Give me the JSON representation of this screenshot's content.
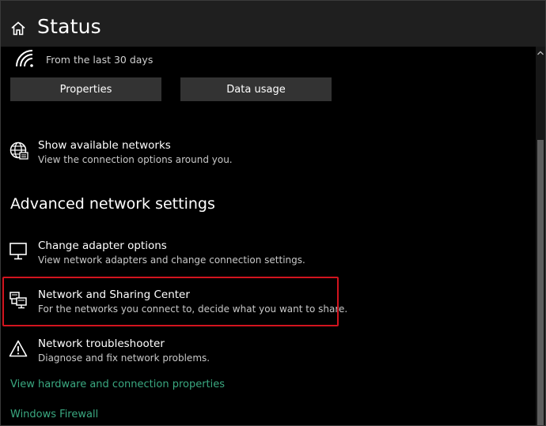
{
  "header": {
    "title": "Status",
    "home_icon": "home-icon"
  },
  "connection": {
    "usage_period": "From the last 30 days",
    "wifi_icon": "wifi-icon"
  },
  "buttons": {
    "properties": "Properties",
    "data_usage": "Data usage"
  },
  "items": {
    "available": {
      "title": "Show available networks",
      "description": "View the connection options around you.",
      "icon": "globe-icon"
    },
    "adapter": {
      "title": "Change adapter options",
      "description": "View network adapters and change connection settings.",
      "icon": "monitor-icon"
    },
    "sharing": {
      "title": "Network and Sharing Center",
      "description": "For the networks you connect to, decide what you want to share.",
      "icon": "network-sharing-icon"
    },
    "troubleshooter": {
      "title": "Network troubleshooter",
      "description": "Diagnose and fix network problems.",
      "icon": "warning-icon"
    }
  },
  "advanced": {
    "heading": "Advanced network settings"
  },
  "links": {
    "hardware": "View hardware and connection properties",
    "firewall": "Windows Firewall"
  },
  "colors": {
    "background": "#000000",
    "header_background": "#1f1f1f",
    "button_background": "#333333",
    "link": "#3aa981",
    "highlight": "#d2141e"
  }
}
